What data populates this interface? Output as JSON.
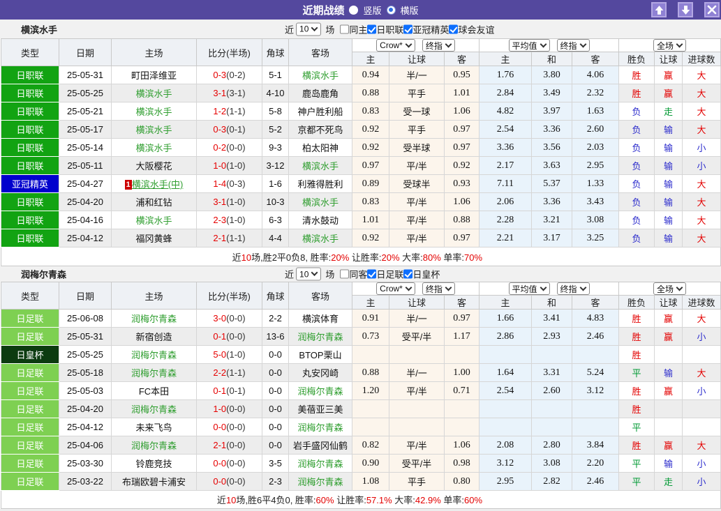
{
  "titlebar": {
    "title": "近期战绩",
    "radios": [
      {
        "label": "竖版",
        "selected": false
      },
      {
        "label": "横版",
        "selected": true
      }
    ],
    "buttons": [
      {
        "name": "up",
        "icon": "arrow-up-icon"
      },
      {
        "name": "down",
        "icon": "arrow-down-icon"
      },
      {
        "name": "close",
        "icon": "close-icon"
      }
    ]
  },
  "palette": {
    "titlebar_bg": "#54489E",
    "league_colors": {
      "日职联": "#12A312",
      "亚冠精英": "#0101CD",
      "日足联": "#7ED052",
      "日皇杯": "#0C3B10"
    },
    "result_colors": {
      "胜": "#E30000",
      "平": "#009933",
      "负": "#2B2BCC",
      "赢": "#E30000",
      "走": "#009933",
      "输": "#2B2BCC",
      "大": "#E30000",
      "小": "#2B2BCC"
    },
    "self_team_color": "#2F9E2F",
    "score_color": "#E60000",
    "badge_bg": "#CC0000",
    "checkbox_color": "#0D6EFD"
  },
  "table_columns": [
    "类型",
    "日期",
    "主场",
    "比分(半场)",
    "角球",
    "客场"
  ],
  "odds_subcolumns": [
    "主",
    "让球",
    "客",
    "主",
    "和",
    "客",
    "胜负",
    "让球",
    "进球数"
  ],
  "sections": [
    {
      "team": "横滨水手",
      "filter": {
        "near_label": "近",
        "count": "10",
        "games_label": "场",
        "same_label": "同主",
        "same_checked": false,
        "leagues": [
          {
            "label": "日职联",
            "checked": true
          },
          {
            "label": "亚冠精英",
            "checked": true
          },
          {
            "label": "球会友谊",
            "checked": true
          }
        ]
      },
      "odds_selects": {
        "group1": [
          "Crow*",
          "终指"
        ],
        "group2": [
          "平均值",
          "终指"
        ],
        "group3": [
          "全场"
        ]
      },
      "rows": [
        {
          "league": "日职联",
          "date": "25-05-31",
          "home": "町田泽维亚",
          "home_self": false,
          "score": "0-3",
          "half": "0-2",
          "corners": "5-1",
          "away": "横滨水手",
          "away_self": true,
          "crow": [
            "0.94",
            "半/一",
            "0.95"
          ],
          "avg": [
            "1.76",
            "3.80",
            "4.06"
          ],
          "results": [
            "胜",
            "赢",
            "大"
          ]
        },
        {
          "league": "日职联",
          "date": "25-05-25",
          "home": "横滨水手",
          "home_self": true,
          "score": "3-1",
          "half": "3-1",
          "corners": "4-10",
          "away": "鹿岛鹿角",
          "away_self": false,
          "crow": [
            "0.88",
            "平手",
            "1.01"
          ],
          "avg": [
            "2.84",
            "3.49",
            "2.32"
          ],
          "results": [
            "胜",
            "赢",
            "大"
          ]
        },
        {
          "league": "日职联",
          "date": "25-05-21",
          "home": "横滨水手",
          "home_self": true,
          "score": "1-2",
          "half": "1-1",
          "corners": "5-8",
          "away": "神户胜利船",
          "away_self": false,
          "crow": [
            "0.83",
            "受一球",
            "1.06"
          ],
          "avg": [
            "4.82",
            "3.97",
            "1.63"
          ],
          "results": [
            "负",
            "走",
            "大"
          ]
        },
        {
          "league": "日职联",
          "date": "25-05-17",
          "home": "横滨水手",
          "home_self": true,
          "score": "0-3",
          "half": "0-1",
          "corners": "5-2",
          "away": "京都不死鸟",
          "away_self": false,
          "crow": [
            "0.92",
            "平手",
            "0.97"
          ],
          "avg": [
            "2.54",
            "3.36",
            "2.60"
          ],
          "results": [
            "负",
            "输",
            "大"
          ]
        },
        {
          "league": "日职联",
          "date": "25-05-14",
          "home": "横滨水手",
          "home_self": true,
          "score": "0-2",
          "half": "0-0",
          "corners": "9-3",
          "away": "柏太阳神",
          "away_self": false,
          "crow": [
            "0.92",
            "受半球",
            "0.97"
          ],
          "avg": [
            "3.36",
            "3.56",
            "2.03"
          ],
          "results": [
            "负",
            "输",
            "小"
          ]
        },
        {
          "league": "日职联",
          "date": "25-05-11",
          "home": "大阪樱花",
          "home_self": false,
          "score": "1-0",
          "half": "1-0",
          "corners": "3-12",
          "away": "横滨水手",
          "away_self": true,
          "crow": [
            "0.97",
            "平/半",
            "0.92"
          ],
          "avg": [
            "2.17",
            "3.63",
            "2.95"
          ],
          "results": [
            "负",
            "输",
            "小"
          ]
        },
        {
          "league": "亚冠精英",
          "date": "25-04-27",
          "home": "横滨水手(中)",
          "home_self": true,
          "home_badge": "1",
          "home_underline": true,
          "score": "1-4",
          "half": "0-3",
          "corners": "1-6",
          "away": "利雅得胜利",
          "away_self": false,
          "crow": [
            "0.89",
            "受球半",
            "0.93"
          ],
          "avg": [
            "7.11",
            "5.37",
            "1.33"
          ],
          "results": [
            "负",
            "输",
            "大"
          ]
        },
        {
          "league": "日职联",
          "date": "25-04-20",
          "home": "浦和红钻",
          "home_self": false,
          "score": "3-1",
          "half": "1-0",
          "corners": "10-3",
          "away": "横滨水手",
          "away_self": true,
          "crow": [
            "0.83",
            "平/半",
            "1.06"
          ],
          "avg": [
            "2.06",
            "3.36",
            "3.43"
          ],
          "results": [
            "负",
            "输",
            "大"
          ]
        },
        {
          "league": "日职联",
          "date": "25-04-16",
          "home": "横滨水手",
          "home_self": true,
          "score": "2-3",
          "half": "1-0",
          "corners": "6-3",
          "away": "清水鼓动",
          "away_self": false,
          "crow": [
            "1.01",
            "平/半",
            "0.88"
          ],
          "avg": [
            "2.28",
            "3.21",
            "3.08"
          ],
          "results": [
            "负",
            "输",
            "大"
          ]
        },
        {
          "league": "日职联",
          "date": "25-04-12",
          "home": "福冈黄蜂",
          "home_self": false,
          "score": "2-1",
          "half": "1-1",
          "corners": "4-4",
          "away": "横滨水手",
          "away_self": true,
          "crow": [
            "0.92",
            "平/半",
            "0.97"
          ],
          "avg": [
            "2.21",
            "3.17",
            "3.25"
          ],
          "results": [
            "负",
            "输",
            "大"
          ]
        }
      ],
      "summary": [
        {
          "t": "近",
          "red": false
        },
        {
          "t": "10",
          "red": true
        },
        {
          "t": "场,胜2平0负8, 胜率:",
          "red": false
        },
        {
          "t": "20%",
          "red": true
        },
        {
          "t": " 让胜率:",
          "red": false
        },
        {
          "t": "20%",
          "red": true
        },
        {
          "t": " 大率:",
          "red": false
        },
        {
          "t": "80%",
          "red": true
        },
        {
          "t": " 单率:",
          "red": false
        },
        {
          "t": "70%",
          "red": true
        }
      ]
    },
    {
      "team": "润梅尔青森",
      "filter": {
        "near_label": "近",
        "count": "10",
        "games_label": "场",
        "same_label": "同客",
        "same_checked": false,
        "leagues": [
          {
            "label": "日足联",
            "checked": true
          },
          {
            "label": "日皇杯",
            "checked": true
          }
        ]
      },
      "odds_selects": {
        "group1": [
          "Crow*",
          "终指"
        ],
        "group2": [
          "平均值",
          "终指"
        ],
        "group3": [
          "全场"
        ]
      },
      "rows": [
        {
          "league": "日足联",
          "date": "25-06-08",
          "home": "润梅尔青森",
          "home_self": true,
          "score": "3-0",
          "half": "0-0",
          "corners": "2-2",
          "away": "横滨体育",
          "away_self": false,
          "crow": [
            "0.91",
            "半/一",
            "0.97"
          ],
          "avg": [
            "1.66",
            "3.41",
            "4.83"
          ],
          "results": [
            "胜",
            "赢",
            "大"
          ]
        },
        {
          "league": "日足联",
          "date": "25-05-31",
          "home": "新宿创造",
          "home_self": false,
          "score": "0-1",
          "half": "0-0",
          "corners": "13-6",
          "away": "润梅尔青森",
          "away_self": true,
          "crow": [
            "0.73",
            "受平/半",
            "1.17"
          ],
          "avg": [
            "2.86",
            "2.93",
            "2.46"
          ],
          "results": [
            "胜",
            "赢",
            "小"
          ]
        },
        {
          "league": "日皇杯",
          "date": "25-05-25",
          "home": "润梅尔青森",
          "home_self": true,
          "score": "5-0",
          "half": "1-0",
          "corners": "0-0",
          "away": "BTOP栗山",
          "away_self": false,
          "crow": [
            "",
            "",
            ""
          ],
          "avg": [
            "",
            "",
            ""
          ],
          "results": [
            "胜",
            "",
            ""
          ]
        },
        {
          "league": "日足联",
          "date": "25-05-18",
          "home": "润梅尔青森",
          "home_self": true,
          "score": "2-2",
          "half": "1-1",
          "corners": "0-0",
          "away": "丸安冈崎",
          "away_self": false,
          "crow": [
            "0.88",
            "半/一",
            "1.00"
          ],
          "avg": [
            "1.64",
            "3.31",
            "5.24"
          ],
          "results": [
            "平",
            "输",
            "大"
          ]
        },
        {
          "league": "日足联",
          "date": "25-05-03",
          "home": "FC本田",
          "home_self": false,
          "score": "0-1",
          "half": "0-1",
          "corners": "0-0",
          "away": "润梅尔青森",
          "away_self": true,
          "crow": [
            "1.20",
            "平/半",
            "0.71"
          ],
          "avg": [
            "2.54",
            "2.60",
            "3.12"
          ],
          "results": [
            "胜",
            "赢",
            "小"
          ]
        },
        {
          "league": "日足联",
          "date": "25-04-20",
          "home": "润梅尔青森",
          "home_self": true,
          "score": "1-0",
          "half": "0-0",
          "corners": "0-0",
          "away": "美蓓亚三美",
          "away_self": false,
          "crow": [
            "",
            "",
            ""
          ],
          "avg": [
            "",
            "",
            ""
          ],
          "results": [
            "胜",
            "",
            ""
          ]
        },
        {
          "league": "日足联",
          "date": "25-04-12",
          "home": "未来飞鸟",
          "home_self": false,
          "score": "0-0",
          "half": "0-0",
          "corners": "0-0",
          "away": "润梅尔青森",
          "away_self": true,
          "crow": [
            "",
            "",
            ""
          ],
          "avg": [
            "",
            "",
            ""
          ],
          "results": [
            "平",
            "",
            ""
          ]
        },
        {
          "league": "日足联",
          "date": "25-04-06",
          "home": "润梅尔青森",
          "home_self": true,
          "score": "2-1",
          "half": "0-0",
          "corners": "0-0",
          "away": "岩手盛冈仙鹤",
          "away_self": false,
          "crow": [
            "0.82",
            "平/半",
            "1.06"
          ],
          "avg": [
            "2.08",
            "2.80",
            "3.84"
          ],
          "results": [
            "胜",
            "赢",
            "大"
          ]
        },
        {
          "league": "日足联",
          "date": "25-03-30",
          "home": "铃鹿竞技",
          "home_self": false,
          "score": "0-0",
          "half": "0-0",
          "corners": "3-5",
          "away": "润梅尔青森",
          "away_self": true,
          "crow": [
            "0.90",
            "受平/半",
            "0.98"
          ],
          "avg": [
            "3.12",
            "3.08",
            "2.20"
          ],
          "results": [
            "平",
            "输",
            "小"
          ]
        },
        {
          "league": "日足联",
          "date": "25-03-22",
          "home": "布瑞欧碧卡浦安",
          "home_self": false,
          "score": "0-0",
          "half": "0-0",
          "corners": "2-3",
          "away": "润梅尔青森",
          "away_self": true,
          "crow": [
            "1.08",
            "平手",
            "0.80"
          ],
          "avg": [
            "2.95",
            "2.82",
            "2.46"
          ],
          "results": [
            "平",
            "走",
            "小"
          ]
        }
      ],
      "summary": [
        {
          "t": "近",
          "red": false
        },
        {
          "t": "10",
          "red": true
        },
        {
          "t": "场,胜6平4负0, 胜率:",
          "red": false
        },
        {
          "t": "60%",
          "red": true
        },
        {
          "t": " 让胜率:",
          "red": false
        },
        {
          "t": "57.1%",
          "red": true
        },
        {
          "t": " 大率:",
          "red": false
        },
        {
          "t": "42.9%",
          "red": true
        },
        {
          "t": " 单率:",
          "red": false
        },
        {
          "t": "60%",
          "red": true
        }
      ]
    }
  ]
}
